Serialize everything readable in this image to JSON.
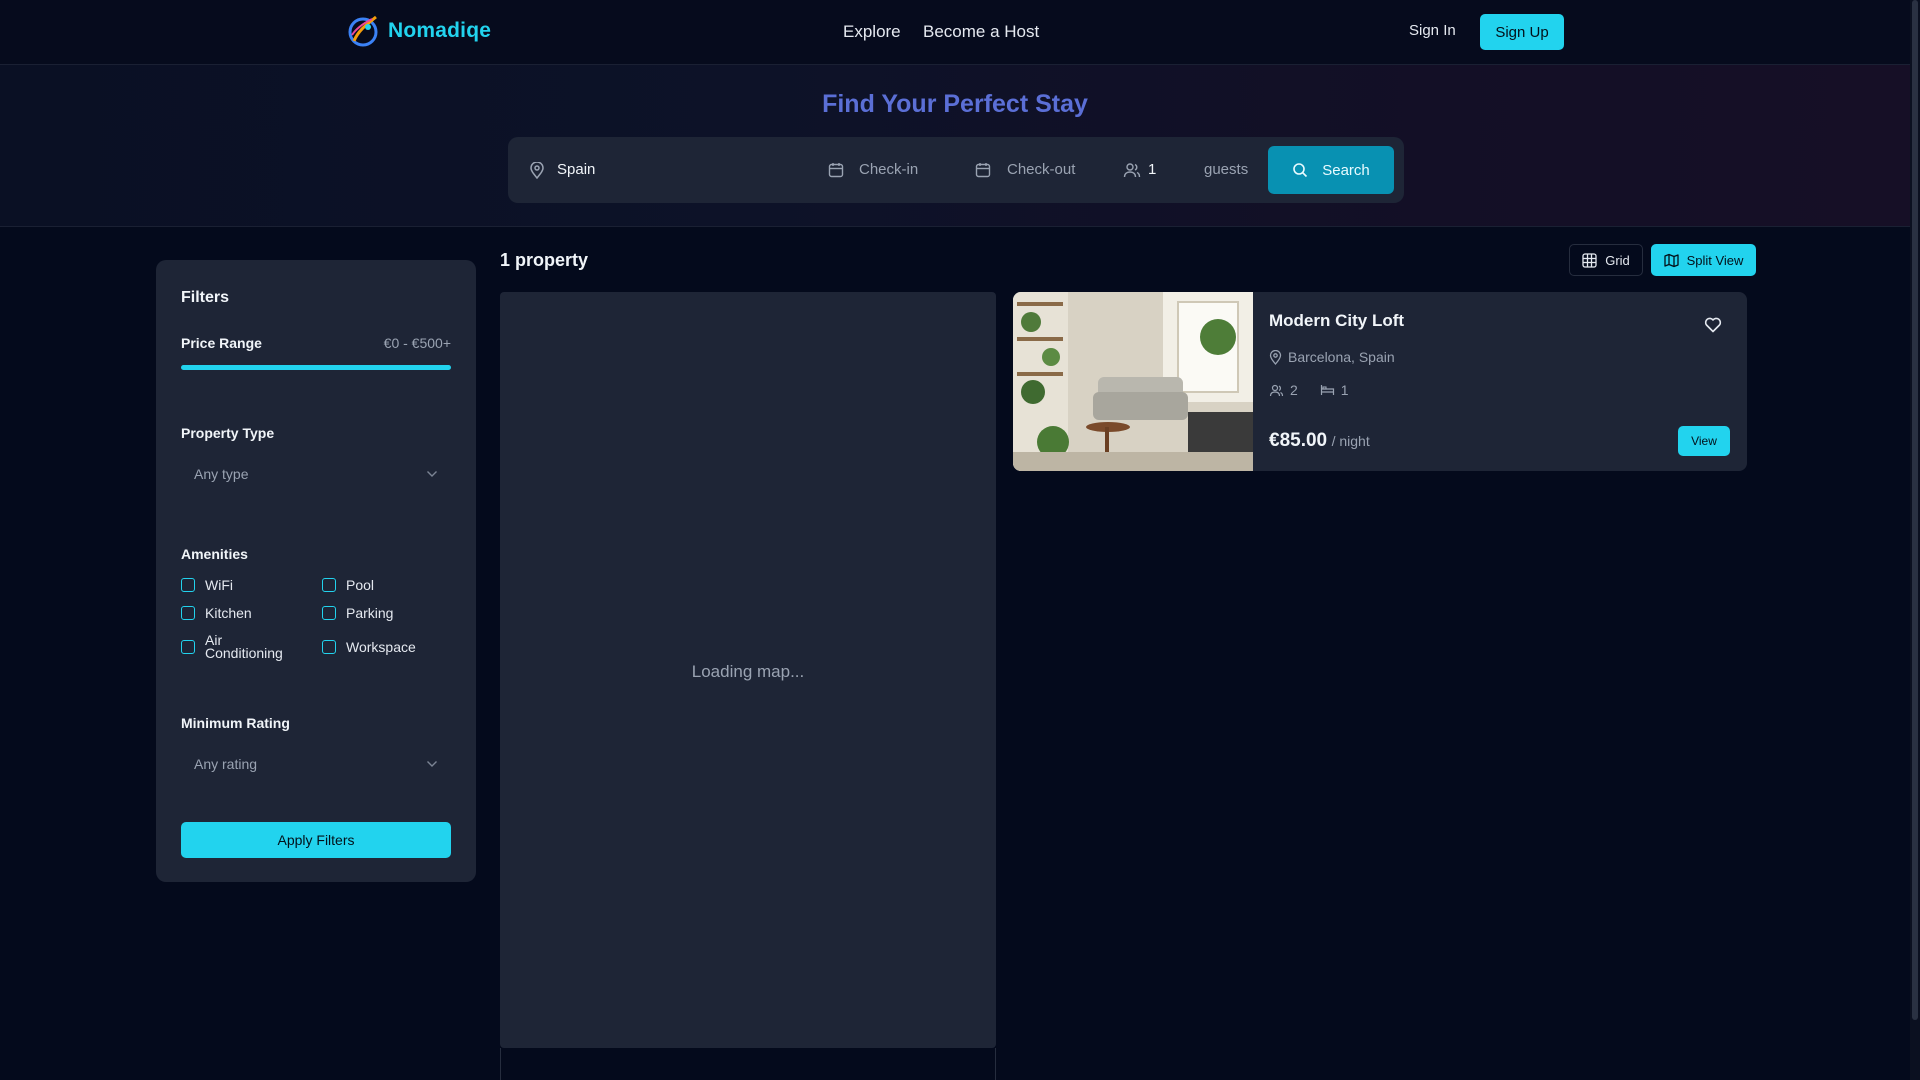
{
  "brand": {
    "name": "Nomadiqe"
  },
  "nav": {
    "explore": "Explore",
    "become_host": "Become a Host",
    "sign_in": "Sign In",
    "sign_up": "Sign Up"
  },
  "hero": {
    "title": "Find Your Perfect Stay"
  },
  "search": {
    "location_value": "Spain",
    "checkin_placeholder": "Check-in",
    "checkout_placeholder": "Check-out",
    "guests_value": "1",
    "guests_label": "guests",
    "search_button": "Search"
  },
  "filters": {
    "title": "Filters",
    "price_range_label": "Price Range",
    "price_range_value": "€0 - €500+",
    "price_range_fill_percent": 100,
    "property_type_label": "Property Type",
    "property_type_value": "Any type",
    "amenities_label": "Amenities",
    "amenities": [
      {
        "label": "WiFi",
        "checked": false
      },
      {
        "label": "Pool",
        "checked": false
      },
      {
        "label": "Kitchen",
        "checked": false
      },
      {
        "label": "Parking",
        "checked": false
      },
      {
        "label": "Air Conditioning",
        "checked": false
      },
      {
        "label": "Workspace",
        "checked": false
      }
    ],
    "min_rating_label": "Minimum Rating",
    "min_rating_value": "Any rating",
    "apply_button": "Apply Filters"
  },
  "results": {
    "count_label": "1 property",
    "view_grid": "Grid",
    "view_split": "Split View",
    "active_view": "Split View",
    "map_loading": "Loading map..."
  },
  "listing": {
    "title": "Modern City Loft",
    "location": "Barcelona, Spain",
    "guests": "2",
    "beds": "1",
    "price": "€85.00",
    "price_unit": "/ night",
    "view_button": "View"
  },
  "colors": {
    "accent": "#22d3ee",
    "search_button": "#0891b2",
    "hero_title": "#5b6fd6",
    "panel": "#1e2536",
    "background": "#040a1c"
  },
  "icons": {
    "location": "map-pin-icon",
    "calendar": "calendar-icon",
    "guests": "users-icon",
    "search": "search-icon",
    "chevron": "chevron-down-icon",
    "grid": "grid-icon",
    "map": "map-icon",
    "heart": "heart-icon",
    "bed": "bed-icon"
  }
}
